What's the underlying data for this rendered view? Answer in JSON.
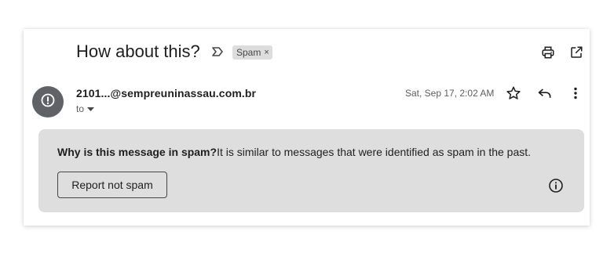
{
  "header": {
    "subject": "How about this?",
    "label_chip": "Spam",
    "label_remove": "×"
  },
  "message": {
    "sender": "2101...@sempreuninassau.com.br",
    "to_label": "to",
    "date": "Sat, Sep 17, 2:02 AM"
  },
  "spam_banner": {
    "question": "Why is this message in spam?",
    "explanation": "It is similar to messages that were identified as spam in the past.",
    "report_button": "Report not spam"
  },
  "icons": {
    "important": "important-marker-icon",
    "print": "print-icon",
    "open_new_window": "open-in-new-window-icon",
    "avatar": "alert-circle-icon",
    "star": "star-icon",
    "reply": "reply-icon",
    "more": "more-vert-icon",
    "to_dropdown": "caret-down-icon",
    "info": "info-icon"
  },
  "colors": {
    "avatar_bg": "#5f6368",
    "banner_bg": "#dedede",
    "chip_bg": "#dddddd"
  }
}
